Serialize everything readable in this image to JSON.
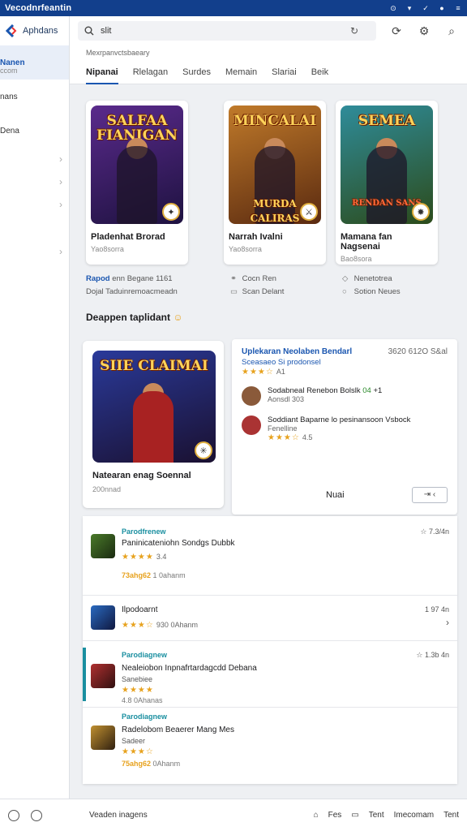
{
  "titlebar": {
    "title": "Vecodnrfeantin"
  },
  "sidebar": {
    "brand": "Aphdans",
    "items": [
      {
        "label": "Nanen",
        "sub": "ccom"
      },
      {
        "label": "nans"
      },
      {
        "label": "Dena"
      }
    ]
  },
  "header": {
    "search_value": "slit"
  },
  "crumb": "Mexrpanvctsbaeary",
  "tabs": [
    "Nipanai",
    "Rlelagan",
    "Surdes",
    "Memain",
    "Slariai",
    "Beik"
  ],
  "featured": [
    {
      "art_title": "SALFAA FIANIGAN",
      "title": "Pladenhat Brorad",
      "sub": "Yao8sorra",
      "colors": [
        "#5a2a8c",
        "#1e1240"
      ]
    },
    {
      "art_title": "MINCALAI",
      "art_sub": "MURDA CALIRAS",
      "title": "Narrah Ivalni",
      "sub": "Yao8sorra",
      "colors": [
        "#c07a2a",
        "#5a2a10"
      ]
    },
    {
      "art_title": "SEMEA",
      "art_sub": "RENDAN SANS",
      "title": "Mamana fan Nagsenai",
      "sub": "Bao8sora",
      "colors": [
        "#2f8c9a",
        "#2c4b1a"
      ]
    }
  ],
  "meta": {
    "col1": {
      "hl": "Rapod",
      "l1": "enn Begane  1161",
      "l2": "Dojal  Taduinremoacmeadn"
    },
    "col2": {
      "l1": "Cocn Ren",
      "l2": "Scan Delant"
    },
    "col3": {
      "l1": "Nenetotrea",
      "l2": "Sotion Neues"
    }
  },
  "section_title": "Deappen taplidant",
  "big_card": {
    "art_title": "SIIE CLAIMAI",
    "title": "Natearan enag Soennal",
    "sub": "200nnad"
  },
  "reviews": {
    "title": "Uplekaran Neolaben Bendarl",
    "date": "3620 612O S&al",
    "subtitle": "Sceasaeo Si prodonsel",
    "stars": "★★★☆",
    "score": "A1",
    "users": [
      {
        "name": "Sodabneal Renebon Bolslk",
        "score": "04",
        "extra": "+1",
        "line": "Aonsdl 303"
      },
      {
        "name": "Soddiant Baparne lo pesinansoon Vsbock",
        "line": "Fenelline",
        "stars": "★★★☆",
        "score": "4.5"
      }
    ],
    "footer_label": "Nuai",
    "footer_button": "⇥ ‹"
  },
  "list": [
    {
      "cat": "Parodfrenew",
      "name": "Paninicateniohn Sondgs Dubbk",
      "stars": "★★★★",
      "score": "3.4",
      "extra_bold": "73ahg62",
      "extra": "1 0ahanm",
      "rating": "☆ 7.3/4n"
    },
    {
      "name": "Ilpodoarnt",
      "stars": "★★★☆",
      "extra": "930  0Ahanm",
      "rating": "1 97 4n"
    },
    {
      "cat": "Parodiagnew",
      "name": "Nealeiobon Inpnafrtardagcdd Debana",
      "sub": "Sanebiee",
      "stars": "★★★★",
      "extra": "4.8  0Ahanas",
      "rating": "☆ 1.3b 4n"
    },
    {
      "cat": "Parodiagnew",
      "name": "Radelobom Beaerer Mang Mes",
      "sub": "Sadeer",
      "stars": "★★★☆",
      "extra_bold": "75ahg62",
      "extra": "0Ahanm"
    }
  ],
  "bottombar": {
    "left": "Veaden inagens",
    "right": [
      "Fes",
      "Tent",
      "Imecomam",
      "Tent"
    ]
  }
}
